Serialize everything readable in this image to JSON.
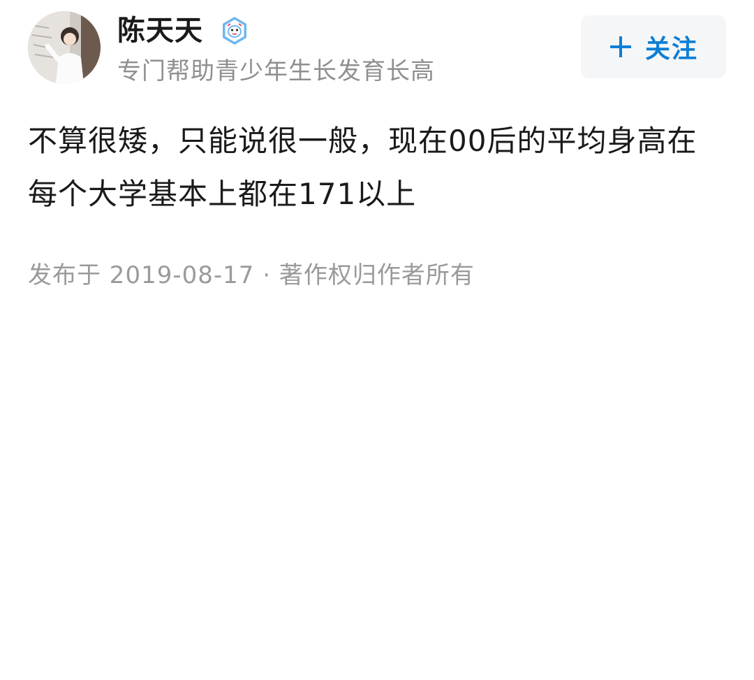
{
  "author": {
    "name": "陈天天",
    "bio": "专门帮助青少年生长发育长高",
    "avatar_icon": "user-avatar-photo",
    "verified_icon": "verified-badge-icon"
  },
  "follow_button": {
    "label": "关注",
    "icon": "plus-icon",
    "color": "#0b7ed6"
  },
  "answer": {
    "text": "不算很矮，只能说很一般，现在00后的平均身高在每个大学基本上都在171以上"
  },
  "meta": {
    "published": "发布于 2019-08-17",
    "separator": "·",
    "copyright": "著作权归作者所有"
  }
}
